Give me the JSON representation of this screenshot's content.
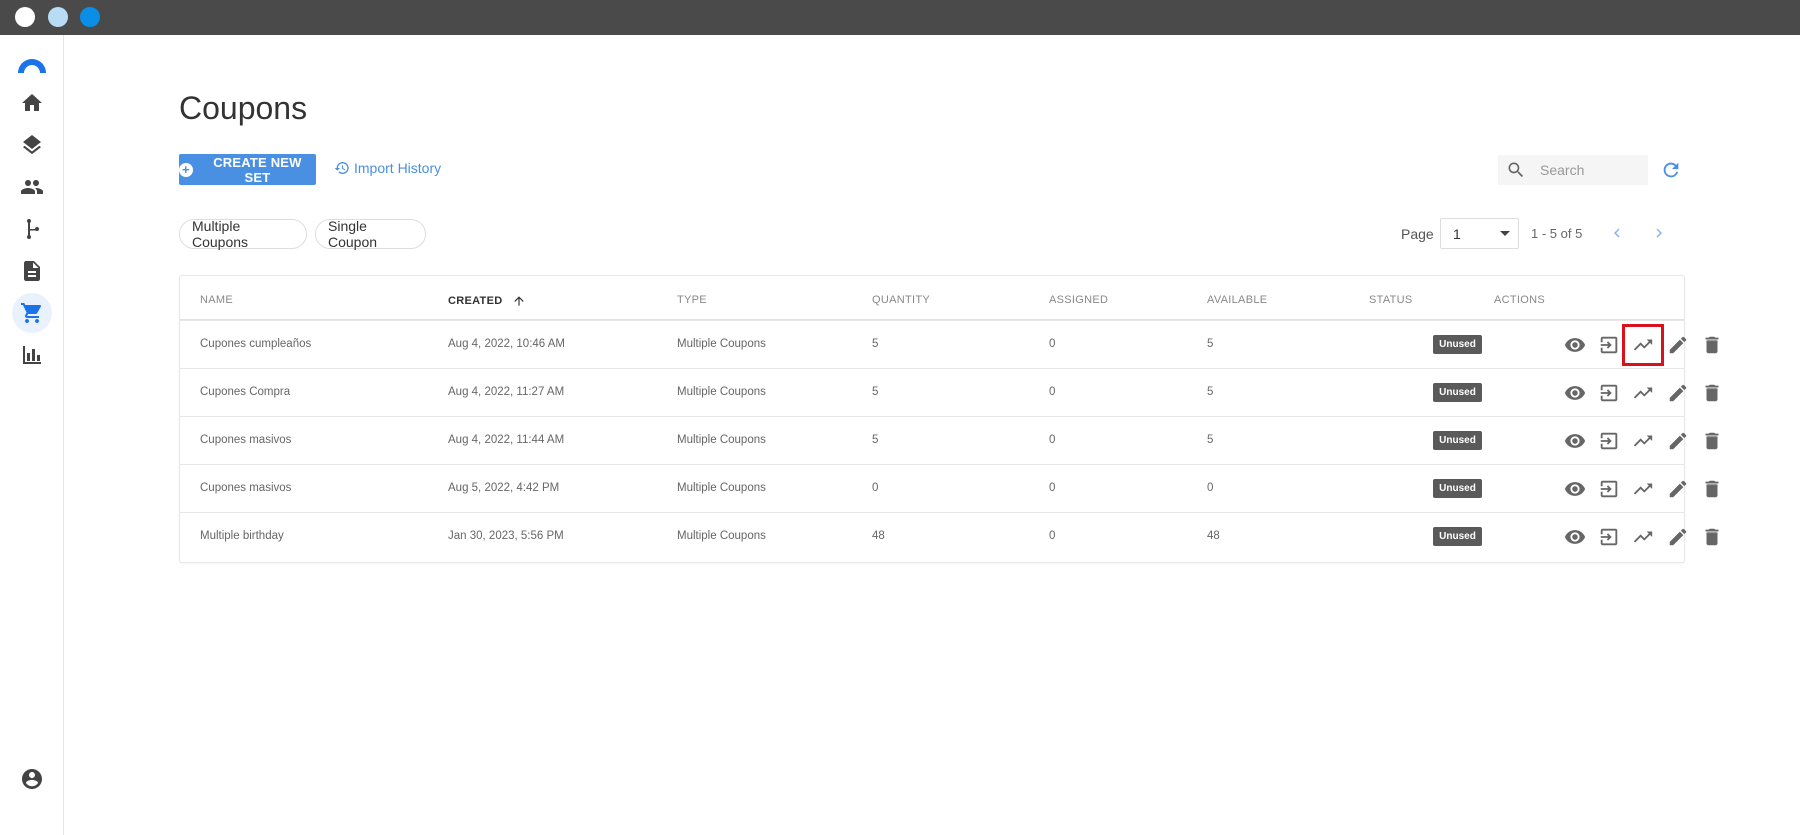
{
  "window": {
    "controls": [
      "close",
      "minimize",
      "maximize"
    ]
  },
  "sidebar": {
    "items": [
      {
        "name": "home",
        "icon": "home-icon"
      },
      {
        "name": "layers",
        "icon": "layers-icon"
      },
      {
        "name": "people",
        "icon": "people-icon"
      },
      {
        "name": "flow",
        "icon": "branch-icon"
      },
      {
        "name": "documents",
        "icon": "document-icon"
      },
      {
        "name": "cart",
        "icon": "cart-icon",
        "active": true
      },
      {
        "name": "analytics",
        "icon": "bar-chart-icon"
      }
    ],
    "footer_icon": "account-icon"
  },
  "header": {
    "title": "Coupons",
    "create_button": "CREATE NEW SET",
    "import_link": "Import History",
    "search_placeholder": "Search"
  },
  "filters": {
    "pills": [
      "Multiple Coupons",
      "Single Coupon"
    ]
  },
  "pagination": {
    "page_label": "Page",
    "page_value": "1",
    "range": "1 - 5 of 5"
  },
  "table": {
    "columns": [
      "NAME",
      "CREATED",
      "TYPE",
      "QUANTITY",
      "ASSIGNED",
      "AVAILABLE",
      "STATUS",
      "ACTIONS"
    ],
    "rows": [
      {
        "name": "Cupones cumpleaños",
        "created": "Aug 4, 2022, 10:46 AM",
        "type": "Multiple Coupons",
        "quantity": "5",
        "assigned": "0",
        "available": "5",
        "status": "Unused"
      },
      {
        "name": "Cupones Compra",
        "created": "Aug 4, 2022, 11:27 AM",
        "type": "Multiple Coupons",
        "quantity": "5",
        "assigned": "0",
        "available": "5",
        "status": "Unused"
      },
      {
        "name": "Cupones masivos",
        "created": "Aug 4, 2022, 11:44 AM",
        "type": "Multiple Coupons",
        "quantity": "5",
        "assigned": "0",
        "available": "5",
        "status": "Unused"
      },
      {
        "name": "Cupones masivos",
        "created": "Aug 5, 2022, 4:42 PM",
        "type": "Multiple Coupons",
        "quantity": "0",
        "assigned": "0",
        "available": "0",
        "status": "Unused"
      },
      {
        "name": "Multiple birthday",
        "created": "Jan 30, 2023, 5:56 PM",
        "type": "Multiple Coupons",
        "quantity": "48",
        "assigned": "0",
        "available": "48",
        "status": "Unused"
      }
    ],
    "row_actions": [
      "view-icon",
      "import-icon",
      "trending-up-icon",
      "edit-icon",
      "delete-icon"
    ]
  },
  "colors": {
    "accent": "#4a90e2",
    "highlight": "#d9111c",
    "badge": "#5a5a5a"
  }
}
